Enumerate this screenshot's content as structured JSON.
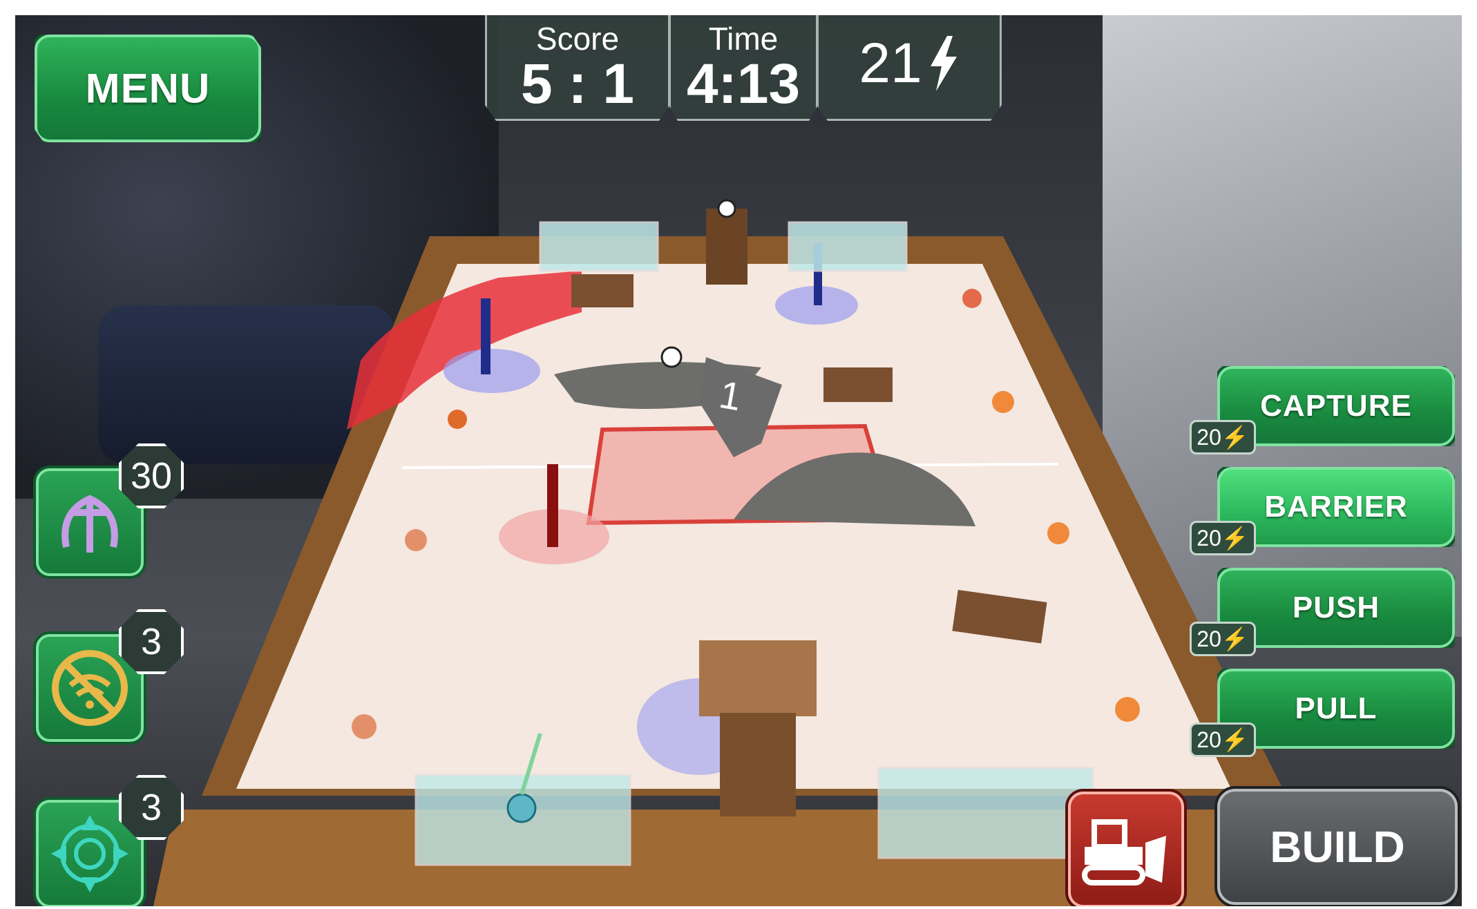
{
  "hud": {
    "score_label": "Score",
    "score_value": "5 : 1",
    "time_label": "Time",
    "time_value": "4:13",
    "energy_value": "21",
    "energy_icon": "lightning-icon"
  },
  "menu": {
    "label": "MENU"
  },
  "skills": [
    {
      "label": "CAPTURE",
      "cost": "20",
      "cost_icon": "lightning-icon",
      "active": false
    },
    {
      "label": "BARRIER",
      "cost": "20",
      "cost_icon": "lightning-icon",
      "active": true
    },
    {
      "label": "PUSH",
      "cost": "20",
      "cost_icon": "lightning-icon",
      "active": false
    },
    {
      "label": "PULL",
      "cost": "20",
      "cost_icon": "lightning-icon",
      "active": false
    }
  ],
  "abilities": [
    {
      "icon": "anchor-hook-icon",
      "count": "30",
      "color": "#c59ce6"
    },
    {
      "icon": "no-signal-icon",
      "count": "3",
      "color": "#e8b84a"
    },
    {
      "icon": "mandala-icon",
      "count": "3",
      "color": "#3fd6c0"
    }
  ],
  "build": {
    "label": "BUILD",
    "bulldozer_icon": "bulldozer-icon"
  },
  "field": {
    "marker_label": "1",
    "colors": {
      "red_team": "#e8303a",
      "blue_team": "#5577ff",
      "table_wood": "#a06a35",
      "floor": "#f3e9e1"
    }
  }
}
